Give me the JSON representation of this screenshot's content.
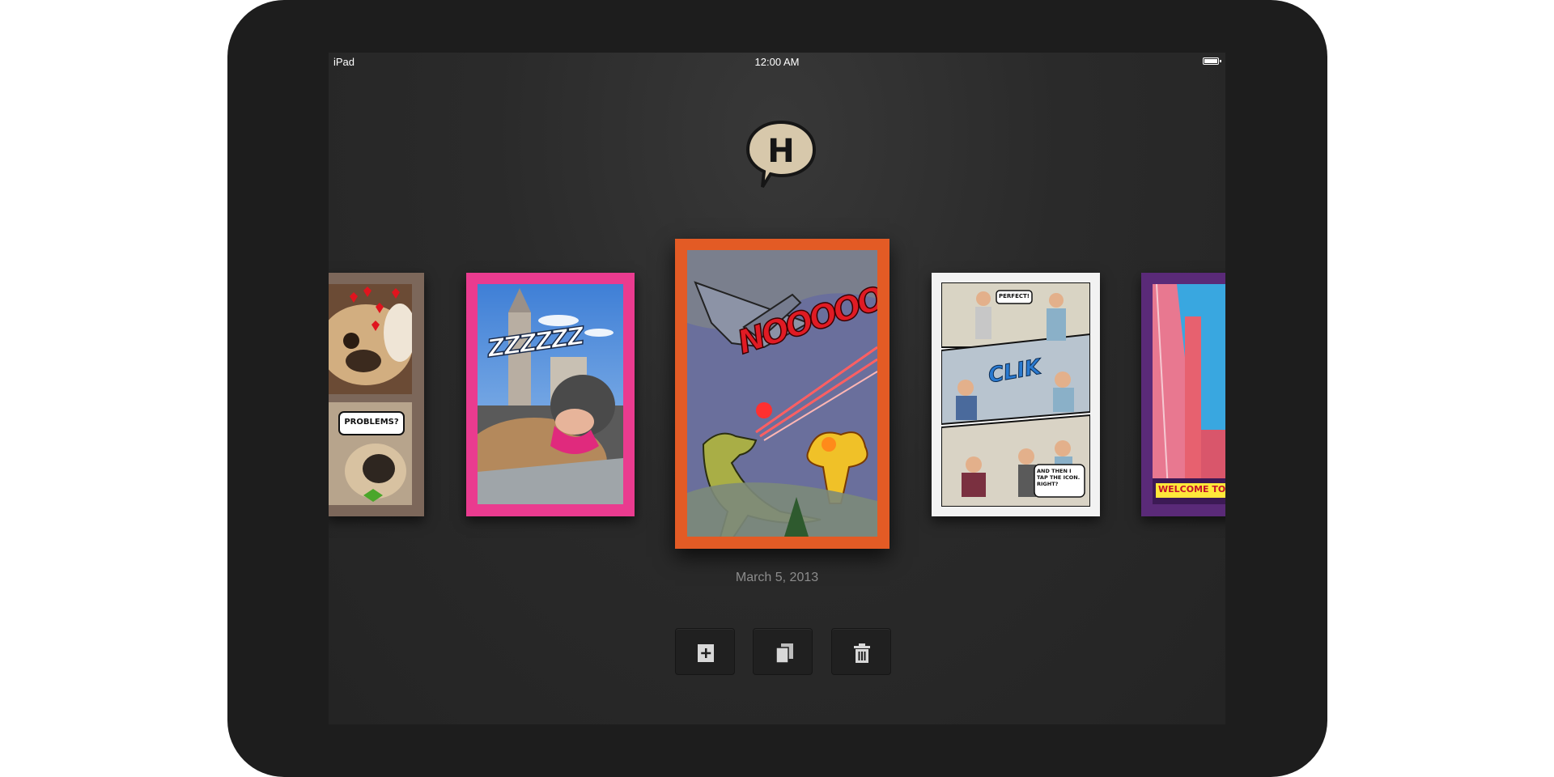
{
  "status_bar": {
    "carrier": "iPad",
    "time": "12:00 AM",
    "battery_level": 1.0
  },
  "app": {
    "logo_letter": "H"
  },
  "comics": [
    {
      "cover_color": "#7c675a",
      "captions": [
        "PROBLEMS?"
      ]
    },
    {
      "cover_color": "#ea3b8f",
      "captions": [
        "ZZZZZZ"
      ]
    },
    {
      "cover_color": "#e35b25",
      "captions": [
        "NOOOOOO!!"
      ],
      "selected": true
    },
    {
      "cover_color": "#f2f2f2",
      "captions": [
        "PERFECT!",
        "CLIK",
        "AND THEN I TAP THE ICON. RIGHT?"
      ]
    },
    {
      "cover_color": "#5a2a78",
      "captions": [
        "WELCOME TO"
      ]
    }
  ],
  "selected_comic": {
    "date": "March 5, 2013"
  },
  "toolbar": {
    "buttons": [
      {
        "name": "new-comic",
        "icon": "plus-icon"
      },
      {
        "name": "duplicate-comic",
        "icon": "duplicate-icon"
      },
      {
        "name": "delete-comic",
        "icon": "trash-icon"
      }
    ]
  },
  "colors": {
    "device_bezel": "#1d1d1d",
    "screen_background": "#2a2a2a",
    "date_text": "#8c8c8c",
    "accent_orange": "#e35b25",
    "accent_pink": "#ea3b8f"
  }
}
